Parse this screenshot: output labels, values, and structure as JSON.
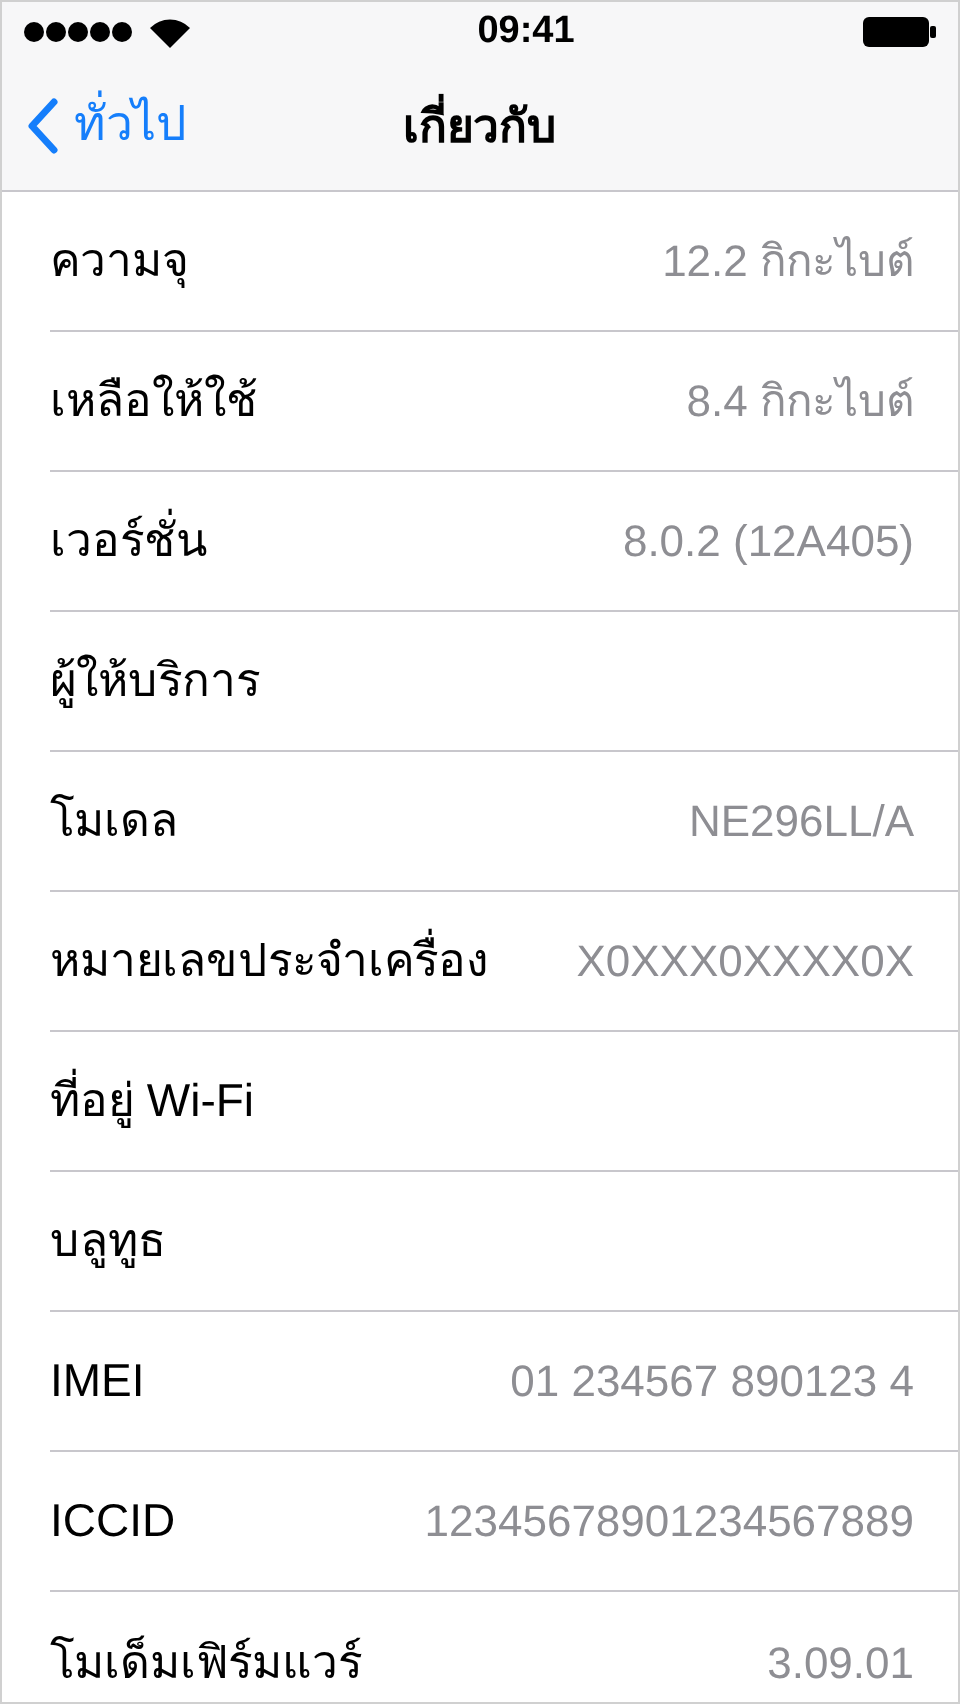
{
  "status_bar": {
    "time": "09:41"
  },
  "nav": {
    "back": "ทั่วไป",
    "title": "เกี่ยวกับ"
  },
  "rows": [
    {
      "label": "ความจุ",
      "value": "12.2 กิกะไบต์"
    },
    {
      "label": "เหลือให้ใช้",
      "value": "8.4 กิกะไบต์"
    },
    {
      "label": "เวอร์ชั่น",
      "value": "8.0.2 (12A405)"
    },
    {
      "label": "ผู้ให้บริการ"
    },
    {
      "label": "โมเดล",
      "value": "NE296LL/A"
    },
    {
      "label": "หมายเลขประจำเครื่อง",
      "value": "X0XXX0XXXX0X"
    },
    {
      "label": "ที่อยู่ Wi-Fi"
    },
    {
      "label": "บลูทูธ"
    },
    {
      "label": "IMEI",
      "value": "01 234567 890123 4"
    },
    {
      "label": "ICCID",
      "value": "12345678901234567889"
    },
    {
      "label": "โมเด็มเฟิร์มแวร์",
      "value": "3.09.01"
    }
  ]
}
